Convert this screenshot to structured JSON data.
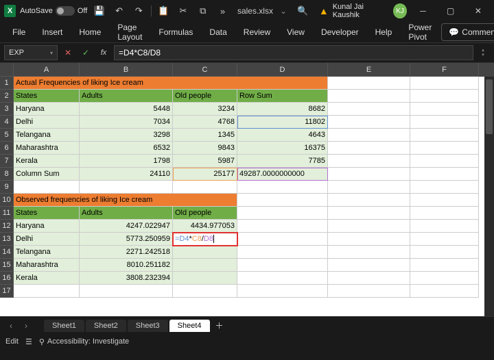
{
  "titlebar": {
    "autosave_label": "AutoSave",
    "autosave_state": "Off",
    "filename": "sales.xlsx",
    "dropdown_glyph": "⌄",
    "ellipsis": "»",
    "user_name": "Kunal Jai Kaushik",
    "user_initials": "KJ"
  },
  "ribbon": {
    "tabs": [
      "File",
      "Insert",
      "Home",
      "Page Layout",
      "Formulas",
      "Data",
      "Review",
      "View",
      "Developer",
      "Help",
      "Power Pivot"
    ],
    "comments": "Comments"
  },
  "formulabar": {
    "namebox": "EXP",
    "formula": "=D4*C8/D8"
  },
  "columns": [
    "A",
    "B",
    "C",
    "D",
    "E",
    "F"
  ],
  "rows": {
    "1": {
      "A": "Actual Frequencies of liking Ice cream"
    },
    "2": {
      "A": "States",
      "B": "Adults",
      "C": "Old people",
      "D": "Row Sum"
    },
    "3": {
      "A": "Haryana",
      "B": "5448",
      "C": "3234",
      "D": "8682"
    },
    "4": {
      "A": "Delhi",
      "B": "7034",
      "C": "4768",
      "D": "11802"
    },
    "5": {
      "A": "Telangana",
      "B": "3298",
      "C": "1345",
      "D": "4643"
    },
    "6": {
      "A": "Maharashtra",
      "B": "6532",
      "C": "9843",
      "D": "16375"
    },
    "7": {
      "A": "Kerala",
      "B": "1798",
      "C": "5987",
      "D": "7785"
    },
    "8": {
      "A": "Column Sum",
      "B": "24110",
      "C": "25177",
      "D": "49287.0000000000"
    },
    "10": {
      "A": "Observed frequencies of liking Ice cream"
    },
    "11": {
      "A": "States",
      "B": "Adults",
      "C": "Old people"
    },
    "12": {
      "A": "Haryana",
      "B": "4247.022947",
      "C": "4434.977053"
    },
    "13": {
      "A": "Delhi",
      "B": "5773.250959",
      "C_formula": {
        "p1": "=D4",
        "p2": "*",
        "p3": "C8",
        "p4": "/",
        "p5": "D8"
      }
    },
    "14": {
      "A": "Telangana",
      "B": "2271.242518"
    },
    "15": {
      "A": "Maharashtra",
      "B": "8010.251182"
    },
    "16": {
      "A": "Kerala",
      "B": "3808.232394"
    }
  },
  "sheets": {
    "tabs": [
      "Sheet1",
      "Sheet2",
      "Sheet3",
      "Sheet4"
    ],
    "active": "Sheet4"
  },
  "statusbar": {
    "mode": "Edit",
    "accessibility": "Accessibility: Investigate"
  }
}
